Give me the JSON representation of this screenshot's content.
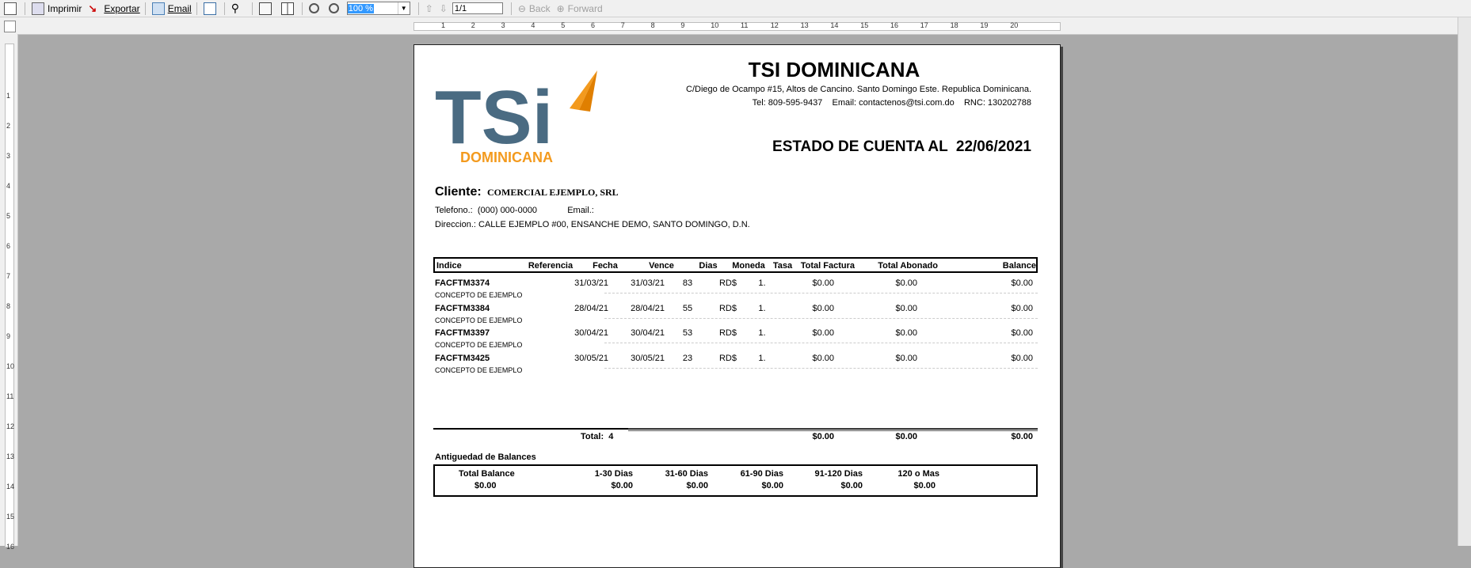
{
  "toolbar": {
    "print_label": "Imprimir",
    "export_label": "Exportar",
    "email_label": "Email",
    "zoom_value": "100 %",
    "page_value": "1/1",
    "back_label": "Back",
    "forward_label": "Forward"
  },
  "ruler": {
    "h_numbers": [
      "1",
      "2",
      "3",
      "4",
      "5",
      "6",
      "7",
      "8",
      "9",
      "10",
      "11",
      "12",
      "13",
      "14",
      "15",
      "16",
      "17",
      "18",
      "19",
      "20"
    ],
    "v_numbers": [
      "1",
      "2",
      "3",
      "4",
      "5",
      "6",
      "7",
      "8",
      "9",
      "10",
      "11",
      "12",
      "13",
      "14",
      "15",
      "16"
    ]
  },
  "company": {
    "name": "TSI DOMINICANA",
    "logo_text": "TSi",
    "logo_subtext": "DOMINICANA",
    "address": "C/Diego de Ocampo #15, Altos de Cancino. Santo Domingo Este. Republica Dominicana.",
    "contact": "Tel: 809-595-9437    Email: contactenos@tsi.com.do    RNC: 130202788"
  },
  "statement": {
    "title": "ESTADO DE CUENTA AL  22/06/2021"
  },
  "client": {
    "label": "Cliente:",
    "name": "COMERCIAL EJEMPLO, SRL",
    "phone_label": "Telefono.:",
    "phone": "(000) 000-0000",
    "email_label": "Email.:",
    "address_label": "Direccion.:",
    "address": "CALLE EJEMPLO #00, ENSANCHE DEMO, SANTO DOMINGO, D.N."
  },
  "table": {
    "headers": [
      "Indice",
      "Referencia",
      "Fecha",
      "Vence",
      "Dias",
      "Moneda",
      "Tasa",
      "Total Factura",
      "Total Abonado",
      "Balance"
    ],
    "rows": [
      {
        "indice": "FACFTM3374",
        "concepto": "CONCEPTO DE EJEMPLO",
        "fecha": "31/03/21",
        "vence": "31/03/21",
        "dias": "83",
        "moneda": "RD$",
        "tasa": "1.",
        "total": "$0.00",
        "abonado": "$0.00",
        "balance": "$0.00"
      },
      {
        "indice": "FACFTM3384",
        "concepto": "CONCEPTO DE EJEMPLO",
        "fecha": "28/04/21",
        "vence": "28/04/21",
        "dias": "55",
        "moneda": "RD$",
        "tasa": "1.",
        "total": "$0.00",
        "abonado": "$0.00",
        "balance": "$0.00"
      },
      {
        "indice": "FACFTM3397",
        "concepto": "CONCEPTO DE EJEMPLO",
        "fecha": "30/04/21",
        "vence": "30/04/21",
        "dias": "53",
        "moneda": "RD$",
        "tasa": "1.",
        "total": "$0.00",
        "abonado": "$0.00",
        "balance": "$0.00"
      },
      {
        "indice": "FACFTM3425",
        "concepto": "CONCEPTO DE EJEMPLO",
        "fecha": "30/05/21",
        "vence": "30/05/21",
        "dias": "23",
        "moneda": "RD$",
        "tasa": "1.",
        "total": "$0.00",
        "abonado": "$0.00",
        "balance": "$0.00"
      }
    ],
    "totals": {
      "label": "Total:",
      "count": "4",
      "total": "$0.00",
      "abonado": "$0.00",
      "balance": "$0.00"
    }
  },
  "aging": {
    "title": "Antiguedad de Balances",
    "headers": [
      "Total Balance",
      "1-30 Dias",
      "31-60 Dias",
      "61-90 Dias",
      "91-120 Dias",
      "120 o Mas"
    ],
    "values": [
      "$0.00",
      "$0.00",
      "$0.00",
      "$0.00",
      "$0.00",
      "$0.00"
    ]
  },
  "colors": {
    "logo_blue": "#4a6b82",
    "logo_orange": "#f39a1e",
    "page_bg": "#a9a9a9"
  }
}
